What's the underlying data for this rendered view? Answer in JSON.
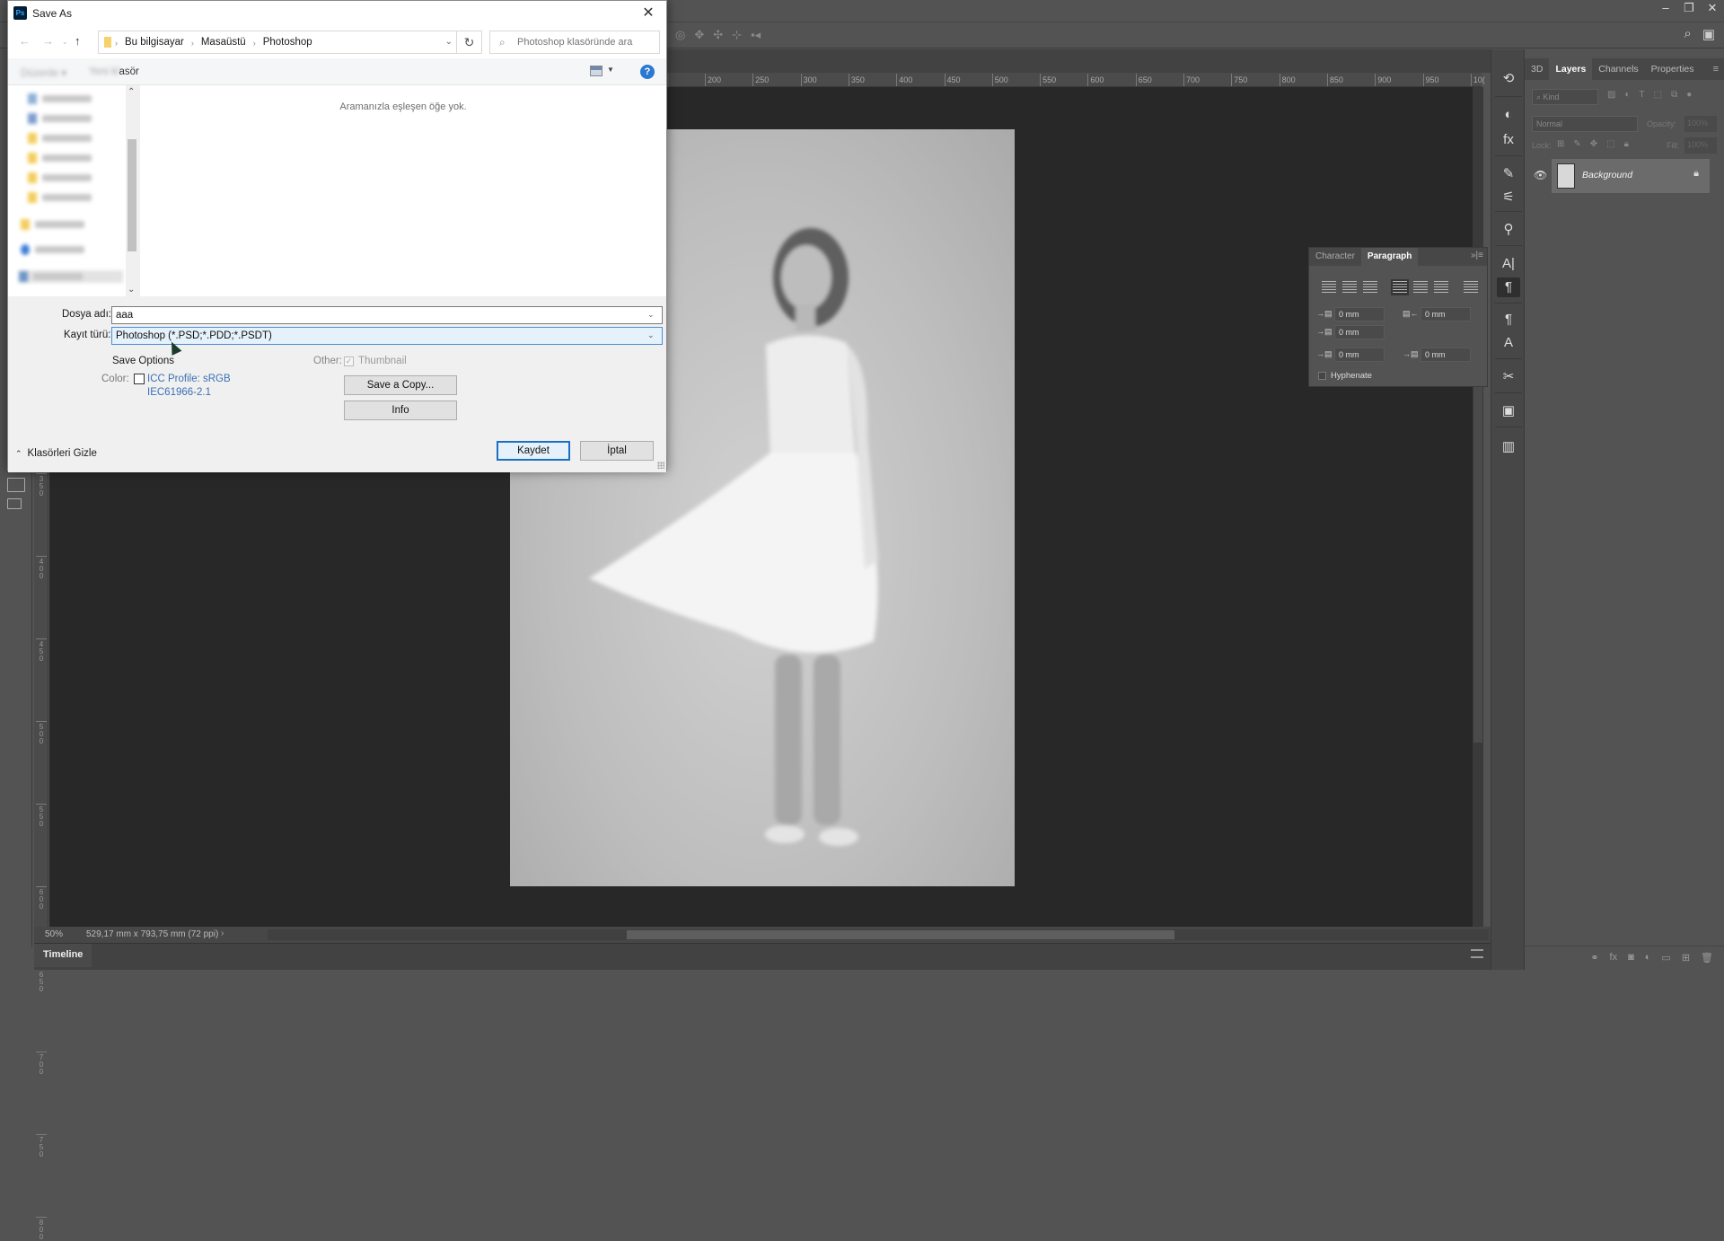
{
  "photoshop": {
    "window_controls": {
      "minimize": "–",
      "restore": "❐",
      "close": "✕"
    },
    "options_bar_icons": [
      "orbit-3d-icon",
      "roll-3d-icon",
      "drag-3d-icon",
      "slide-3d-icon",
      "camera-3d-icon"
    ],
    "ruler_top_ticks": [
      "200",
      "250",
      "300",
      "350",
      "400",
      "450",
      "500",
      "550",
      "600",
      "650",
      "700",
      "750",
      "800",
      "850",
      "900",
      "950",
      "10("
    ],
    "ruler_left_ticks": [
      "350",
      "400",
      "450",
      "500",
      "550",
      "600",
      "650",
      "700",
      "750",
      "800"
    ],
    "status": {
      "zoom": "50%",
      "doc_size": "529,17 mm x 793,75 mm (72 ppi)",
      "arrow": "›"
    },
    "timeline_tab": "Timeline",
    "layers_panel": {
      "tabs": [
        {
          "label": "3D",
          "active": false
        },
        {
          "label": "Layers",
          "active": true
        },
        {
          "label": "Channels",
          "active": false
        },
        {
          "label": "Properties",
          "active": false
        }
      ],
      "filter_placeholder": "Kind",
      "blend_mode": "Normal",
      "opacity_label": "Opacity:",
      "opacity_value": "100%",
      "lock_label": "Lock:",
      "fill_label": "Fill:",
      "fill_value": "100%",
      "layers": [
        {
          "name": "Background",
          "visible": true,
          "locked": true
        }
      ]
    },
    "paragraph_panel": {
      "tabs": [
        {
          "label": "Character",
          "active": false
        },
        {
          "label": "Paragraph",
          "active": true
        }
      ],
      "controls": "»|≡",
      "indent_left": "0 mm",
      "indent_right": "0 mm",
      "indent_first_line": "0 mm",
      "space_before": "0 mm",
      "space_after": "0 mm",
      "hyphenate_label": "Hyphenate",
      "hyphenate_checked": false,
      "active_align": "justify-last-left"
    }
  },
  "dialog": {
    "title": "Save As",
    "app_icon": "Ps",
    "close": "✕",
    "breadcrumb": [
      "Bu bilgisayar",
      "Masaüstü",
      "Photoshop"
    ],
    "search_placeholder": "Photoshop klasöründe ara",
    "new_folder_partial": "asör",
    "help": "?",
    "empty_message": "Aramanızla eşleşen öğe yok.",
    "filename_label": "Dosya adı:",
    "filename_value": "aaa",
    "filetype_label": "Kayıt türü:",
    "filetype_value": "Photoshop (*.PSD;*.PDD;*.PSDT)",
    "save_options_label": "Save Options",
    "color_label": "Color:",
    "icc_checked": false,
    "icc_profile_line1": "ICC Profile:  sRGB",
    "icc_profile_line2": "IEC61966-2.1",
    "other_label": "Other:",
    "thumbnail_label": "Thumbnail",
    "thumbnail_checked": true,
    "save_copy_button": "Save a Copy...",
    "info_button": "Info",
    "save_button": "Kaydet",
    "cancel_button": "İptal",
    "hide_folders": "Klasörleri Gizle"
  },
  "colors": {
    "ps_bg": "#535353",
    "canvas_bg": "#282828",
    "dialog_bg": "#f0f0f0",
    "accent_blue": "#1d6fc4",
    "link_blue": "#3b6fb6"
  }
}
